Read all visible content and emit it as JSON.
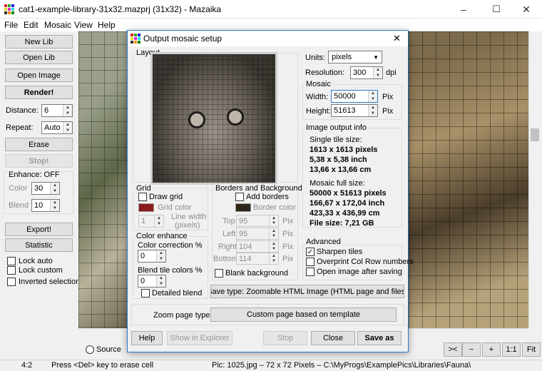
{
  "window": {
    "title": "cat1-example-library-31x32.mazprj (31x32) - Mazaika",
    "minimize": "–",
    "maximize": "☐",
    "close": "✕"
  },
  "menu": [
    "File",
    "Edit",
    "Mosaic",
    "View",
    "Help"
  ],
  "left": {
    "new_lib": "New Lib",
    "open_lib": "Open Lib",
    "open_image": "Open Image",
    "render": "Render!",
    "distance_label": "Distance:",
    "distance_value": "6",
    "repeat_label": "Repeat:",
    "repeat_value": "Auto",
    "erase": "Erase",
    "stop": "Stop!",
    "enhance_label": "Enhance: OFF",
    "color_label": "Color",
    "color_value": "30",
    "blend_label": "Blend",
    "blend_value": "10",
    "export": "Export!",
    "statistic": "Statistic",
    "lock_auto": "Lock auto",
    "lock_custom": "Lock custom",
    "inverted_selection": "Inverted selection"
  },
  "dialog": {
    "title": "Output mosaic setup",
    "close": "✕",
    "layout_label": "Layout",
    "units_label": "Units:",
    "units_value": "pixels",
    "resolution_label": "Resolution:",
    "resolution_value": "300",
    "dpi": "dpi",
    "mosaic_label": "Mosaic",
    "width_label": "Width:",
    "width_value": "50000",
    "width_unit": "Pix",
    "height_label": "Height:",
    "height_value": "51613",
    "height_unit": "Pix",
    "info_label": "Image output info",
    "single_tile_label": "Single tile size:",
    "tile_px": "1613 x 1613 pixels",
    "tile_inch": "5,38 x 5,38 inch",
    "tile_cm": "13,66 x 13,66 cm",
    "full_size_label": "Mosaic full size:",
    "full_px": "50000 x 51613 pixels",
    "full_inch": "166,67 x 172,04 inch",
    "full_cm": "423,33 x 436,99 cm",
    "file_size": "File size: 7,21 GB",
    "grid_label": "Grid",
    "draw_grid": "Draw grid",
    "grid_color": "Grid color",
    "grid_color_hex": "#8b1a1a",
    "line_width_value": "1",
    "line_width_label": "Line width",
    "line_width_unit": "(pixels)",
    "borders_label": "Borders and Background",
    "add_borders": "Add borders",
    "border_color": "Border color",
    "border_color_hex": "#2e2418",
    "top_label": "Top",
    "top_value": "95",
    "left_label": "Left",
    "left_value": "95",
    "right_label": "Right",
    "right_value": "104",
    "bottom_label": "Bottom",
    "bottom_value": "114",
    "pix": "Pix",
    "blank_background": "Blank background",
    "color_enhance_label": "Color enhance",
    "color_correction_label": "Color correction %",
    "color_correction_value": "0",
    "blend_tile_label": "Blend tile colors %",
    "blend_tile_value": "0",
    "detailed_blend": "Detailed blend",
    "advanced_label": "Advanced",
    "sharpen_tiles": "Sharpen tiles",
    "overprint": "Overprint Col Row numbers",
    "open_after": "Open image after saving",
    "save_type": "Save type: Zoomable HTML Image (HTML page and files)",
    "zoom_page_type_label": "Zoom page type:",
    "zoom_page_type_value": "Custom page based on template",
    "help": "Help",
    "show_in_explorer": "Show in Explorer",
    "stop": "Stop",
    "close_btn": "Close",
    "save_as": "Save as"
  },
  "bottom": {
    "source": "Source",
    "nav_back": "><",
    "minus": "−",
    "plus": "+",
    "one_one": "1:1",
    "fit": "Fit"
  },
  "status": {
    "zoom": "4:2",
    "hint": "Press <Del> key to erase cell",
    "pic": "Pic: 1025.jpg  –  72 x 72 Pixels  –  C:\\MyProgs\\ExamplePics\\Libraries\\Fauna\\"
  }
}
